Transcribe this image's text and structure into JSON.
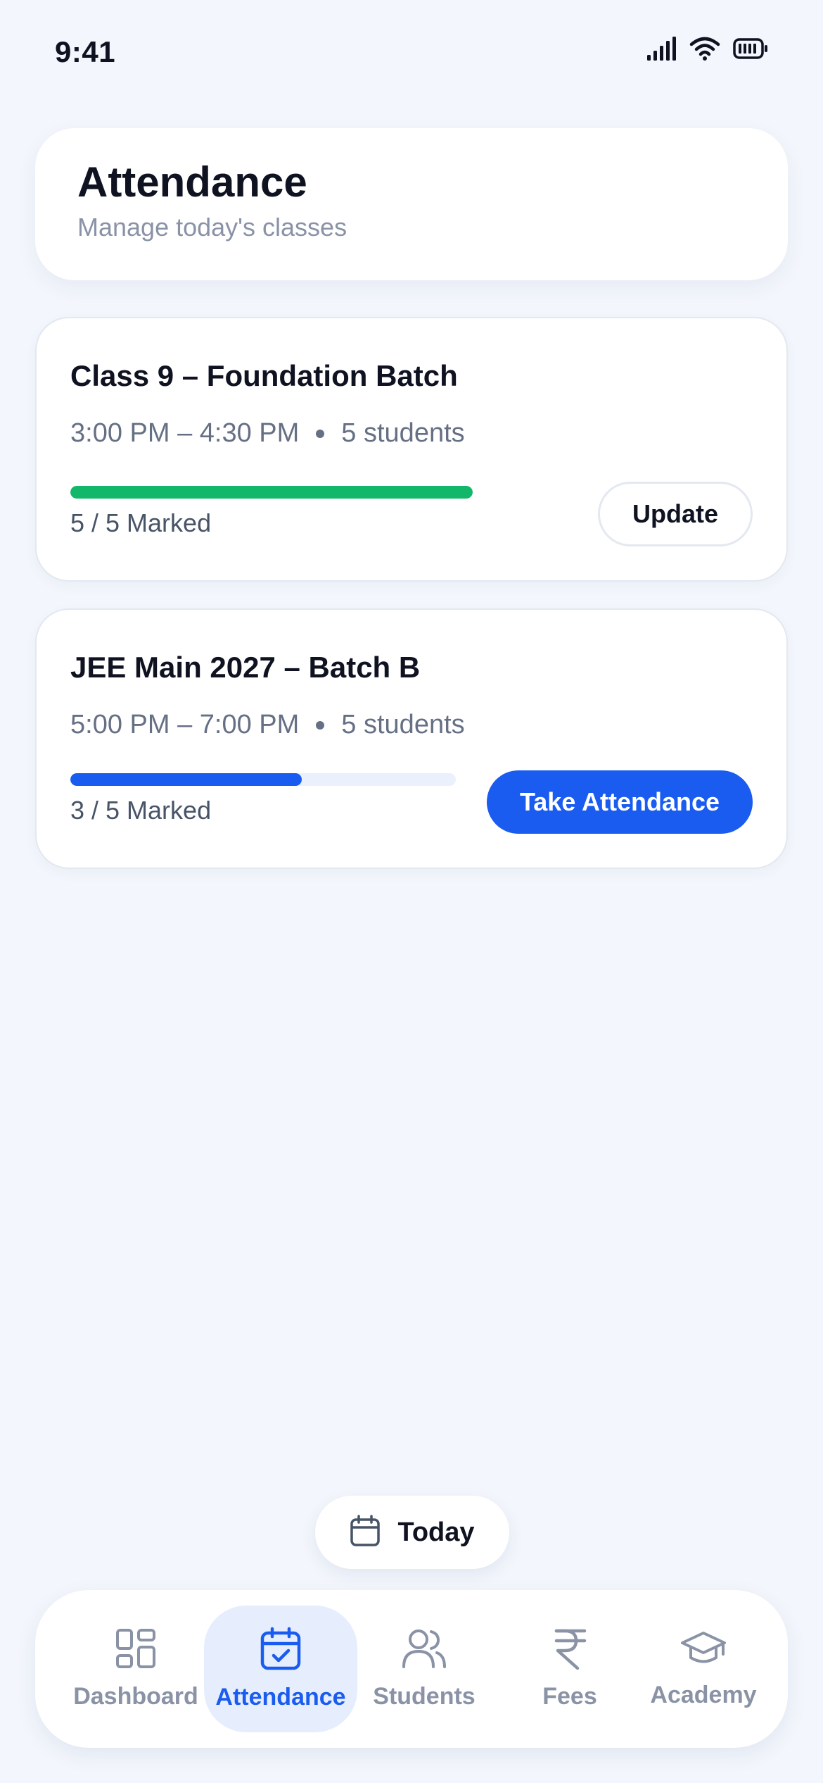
{
  "status_bar": {
    "time": "9:41",
    "icons": [
      "cellular-signal-icon",
      "wifi-icon",
      "battery-icon"
    ]
  },
  "header": {
    "title": "Attendance",
    "subtitle": "Manage today's classes"
  },
  "classes": [
    {
      "title": "Class 9 – Foundation Batch",
      "time": "3:00 PM – 4:30 PM",
      "students": "5 students",
      "marked": 5,
      "total": 5,
      "marked_text": "5 / 5 Marked",
      "progress_fraction": 1.0,
      "progress_color": "#12b76a",
      "action_label": "Update"
    },
    {
      "title": "JEE Main 2027 – Batch B",
      "time": "5:00 PM – 7:00 PM",
      "students": "5 students",
      "marked": 3,
      "total": 5,
      "marked_text": "3 / 5 Marked",
      "progress_fraction": 0.6,
      "progress_color": "#1a5cf0",
      "action_label": "Take Attendance"
    }
  ],
  "today_button": {
    "label": "Today",
    "icon": "calendar-icon"
  },
  "bottom_nav": {
    "active": "attendance",
    "items": [
      {
        "id": "dashboard",
        "label": "Dashboard",
        "icon": "grid-icon"
      },
      {
        "id": "attendance",
        "label": "Attendance",
        "icon": "calendar-check-icon"
      },
      {
        "id": "students",
        "label": "Students",
        "icon": "users-icon"
      },
      {
        "id": "fees",
        "label": "Fees",
        "icon": "rupee-icon"
      },
      {
        "id": "academy",
        "label": "Academy",
        "icon": "graduation-cap-icon"
      }
    ]
  },
  "colors": {
    "background": "#f3f6fc",
    "accent": "#1a5cf0",
    "success": "#12b76a",
    "muted": "#8a92a6"
  }
}
